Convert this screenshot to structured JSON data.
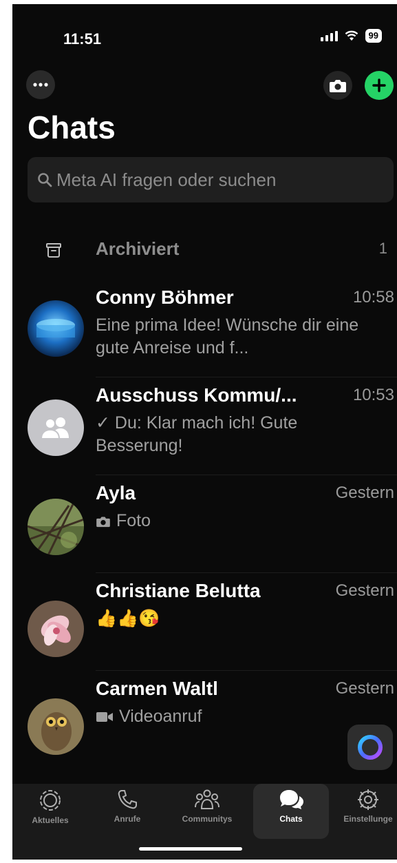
{
  "status_bar": {
    "time": "11:51",
    "battery": "99"
  },
  "header": {
    "title": "Chats"
  },
  "search": {
    "placeholder": "Meta AI fragen oder suchen"
  },
  "archived": {
    "label": "Archiviert",
    "count": "1"
  },
  "chats": [
    {
      "name": "Conny Böhmer",
      "time": "10:58",
      "preview": "Eine prima Idee! Wünsche dir eine gute Anreise und f..."
    },
    {
      "name": "Ausschuss Kommu/...",
      "time": "10:53",
      "preview_check": "✓",
      "preview": "Du: Klar mach ich! Gute Besserung!"
    },
    {
      "name": "Ayla",
      "time": "Gestern",
      "preview_icon": "camera-icon",
      "preview": "Foto"
    },
    {
      "name": "Christiane Belutta",
      "time": "Gestern",
      "preview": "👍👍😘"
    },
    {
      "name": "Carmen Waltl",
      "time": "Gestern",
      "preview_icon": "video-icon",
      "preview": "Videoanruf"
    }
  ],
  "tabs": [
    {
      "label": "Aktuelles",
      "icon": "updates-icon"
    },
    {
      "label": "Anrufe",
      "icon": "phone-icon"
    },
    {
      "label": "Communitys",
      "icon": "communities-icon"
    },
    {
      "label": "Chats",
      "icon": "chats-icon",
      "active": true
    },
    {
      "label": "Einstellunge",
      "icon": "settings-icon"
    }
  ],
  "colors": {
    "accent": "#25d366",
    "background": "#0a0a0a",
    "secondary_text": "#a0a0a0"
  }
}
